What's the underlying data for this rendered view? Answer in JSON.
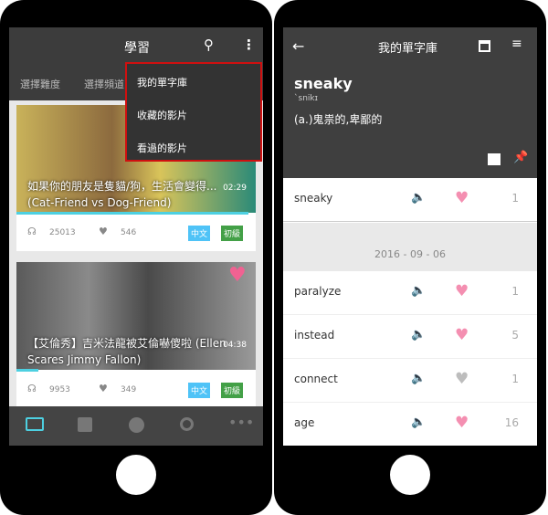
{
  "left": {
    "header": {
      "title": "學習",
      "search_icon": "search-icon",
      "more_icon": "more-vert-icon"
    },
    "tabs": [
      "選擇難度",
      "選擇頻道"
    ],
    "menu": [
      "我的單字庫",
      "收藏的影片",
      "看過的影片"
    ],
    "videos": [
      {
        "title": "如果你的朋友是隻貓/狗，生活會變得... (Cat-Friend vs Dog-Friend)",
        "duration": "02:29",
        "listens": "25013",
        "likes": "546",
        "lang": "中文",
        "level": "初級",
        "progress": 0.97,
        "favorited": false
      },
      {
        "title": "【艾倫秀】吉米法龍被艾倫嚇傻啦 (Ellen Scares Jimmy Fallon)",
        "duration": "04:38",
        "listens": "9953",
        "likes": "349",
        "lang": "中文",
        "level": "初級",
        "progress": 0.09,
        "favorited": true
      }
    ],
    "nav": [
      "tv-icon",
      "article-icon",
      "account-icon",
      "explore-icon",
      "more-horiz-icon"
    ],
    "colors": {
      "accent": "#4dd0e1",
      "lang_badge": "#4fc3f7",
      "level_badge": "#43a047",
      "heart": "#f06292"
    }
  },
  "right": {
    "header": {
      "title": "我的單字庫"
    },
    "word": {
      "text": "sneaky",
      "phonetic": "`snikɪ",
      "definition": "(a.)鬼祟的,卑鄙的"
    },
    "top_row": {
      "word": "sneaky",
      "count": "1",
      "liked": true
    },
    "date": "2016 - 09 - 06",
    "rows": [
      {
        "word": "paralyze",
        "count": "1",
        "liked": true
      },
      {
        "word": "instead",
        "count": "5",
        "liked": true
      },
      {
        "word": "connect",
        "count": "1",
        "liked": false
      },
      {
        "word": "age",
        "count": "16",
        "liked": true
      }
    ],
    "colors": {
      "heart_on": "#f48fb1",
      "heart_off": "#bdbdbd"
    }
  }
}
